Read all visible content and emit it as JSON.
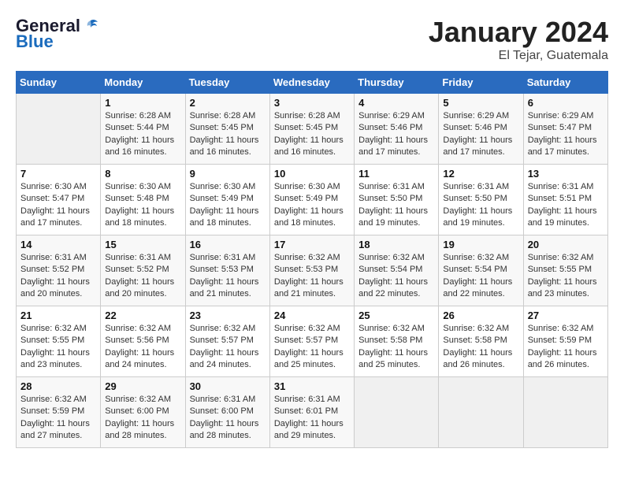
{
  "header": {
    "logo_general": "General",
    "logo_blue": "Blue",
    "month_title": "January 2024",
    "location": "El Tejar, Guatemala"
  },
  "weekdays": [
    "Sunday",
    "Monday",
    "Tuesday",
    "Wednesday",
    "Thursday",
    "Friday",
    "Saturday"
  ],
  "weeks": [
    [
      {
        "day": "",
        "info": ""
      },
      {
        "day": "1",
        "info": "Sunrise: 6:28 AM\nSunset: 5:44 PM\nDaylight: 11 hours\nand 16 minutes."
      },
      {
        "day": "2",
        "info": "Sunrise: 6:28 AM\nSunset: 5:45 PM\nDaylight: 11 hours\nand 16 minutes."
      },
      {
        "day": "3",
        "info": "Sunrise: 6:28 AM\nSunset: 5:45 PM\nDaylight: 11 hours\nand 16 minutes."
      },
      {
        "day": "4",
        "info": "Sunrise: 6:29 AM\nSunset: 5:46 PM\nDaylight: 11 hours\nand 17 minutes."
      },
      {
        "day": "5",
        "info": "Sunrise: 6:29 AM\nSunset: 5:46 PM\nDaylight: 11 hours\nand 17 minutes."
      },
      {
        "day": "6",
        "info": "Sunrise: 6:29 AM\nSunset: 5:47 PM\nDaylight: 11 hours\nand 17 minutes."
      }
    ],
    [
      {
        "day": "7",
        "info": "Sunrise: 6:30 AM\nSunset: 5:47 PM\nDaylight: 11 hours\nand 17 minutes."
      },
      {
        "day": "8",
        "info": "Sunrise: 6:30 AM\nSunset: 5:48 PM\nDaylight: 11 hours\nand 18 minutes."
      },
      {
        "day": "9",
        "info": "Sunrise: 6:30 AM\nSunset: 5:49 PM\nDaylight: 11 hours\nand 18 minutes."
      },
      {
        "day": "10",
        "info": "Sunrise: 6:30 AM\nSunset: 5:49 PM\nDaylight: 11 hours\nand 18 minutes."
      },
      {
        "day": "11",
        "info": "Sunrise: 6:31 AM\nSunset: 5:50 PM\nDaylight: 11 hours\nand 19 minutes."
      },
      {
        "day": "12",
        "info": "Sunrise: 6:31 AM\nSunset: 5:50 PM\nDaylight: 11 hours\nand 19 minutes."
      },
      {
        "day": "13",
        "info": "Sunrise: 6:31 AM\nSunset: 5:51 PM\nDaylight: 11 hours\nand 19 minutes."
      }
    ],
    [
      {
        "day": "14",
        "info": "Sunrise: 6:31 AM\nSunset: 5:52 PM\nDaylight: 11 hours\nand 20 minutes."
      },
      {
        "day": "15",
        "info": "Sunrise: 6:31 AM\nSunset: 5:52 PM\nDaylight: 11 hours\nand 20 minutes."
      },
      {
        "day": "16",
        "info": "Sunrise: 6:31 AM\nSunset: 5:53 PM\nDaylight: 11 hours\nand 21 minutes."
      },
      {
        "day": "17",
        "info": "Sunrise: 6:32 AM\nSunset: 5:53 PM\nDaylight: 11 hours\nand 21 minutes."
      },
      {
        "day": "18",
        "info": "Sunrise: 6:32 AM\nSunset: 5:54 PM\nDaylight: 11 hours\nand 22 minutes."
      },
      {
        "day": "19",
        "info": "Sunrise: 6:32 AM\nSunset: 5:54 PM\nDaylight: 11 hours\nand 22 minutes."
      },
      {
        "day": "20",
        "info": "Sunrise: 6:32 AM\nSunset: 5:55 PM\nDaylight: 11 hours\nand 23 minutes."
      }
    ],
    [
      {
        "day": "21",
        "info": "Sunrise: 6:32 AM\nSunset: 5:55 PM\nDaylight: 11 hours\nand 23 minutes."
      },
      {
        "day": "22",
        "info": "Sunrise: 6:32 AM\nSunset: 5:56 PM\nDaylight: 11 hours\nand 24 minutes."
      },
      {
        "day": "23",
        "info": "Sunrise: 6:32 AM\nSunset: 5:57 PM\nDaylight: 11 hours\nand 24 minutes."
      },
      {
        "day": "24",
        "info": "Sunrise: 6:32 AM\nSunset: 5:57 PM\nDaylight: 11 hours\nand 25 minutes."
      },
      {
        "day": "25",
        "info": "Sunrise: 6:32 AM\nSunset: 5:58 PM\nDaylight: 11 hours\nand 25 minutes."
      },
      {
        "day": "26",
        "info": "Sunrise: 6:32 AM\nSunset: 5:58 PM\nDaylight: 11 hours\nand 26 minutes."
      },
      {
        "day": "27",
        "info": "Sunrise: 6:32 AM\nSunset: 5:59 PM\nDaylight: 11 hours\nand 26 minutes."
      }
    ],
    [
      {
        "day": "28",
        "info": "Sunrise: 6:32 AM\nSunset: 5:59 PM\nDaylight: 11 hours\nand 27 minutes."
      },
      {
        "day": "29",
        "info": "Sunrise: 6:32 AM\nSunset: 6:00 PM\nDaylight: 11 hours\nand 28 minutes."
      },
      {
        "day": "30",
        "info": "Sunrise: 6:31 AM\nSunset: 6:00 PM\nDaylight: 11 hours\nand 28 minutes."
      },
      {
        "day": "31",
        "info": "Sunrise: 6:31 AM\nSunset: 6:01 PM\nDaylight: 11 hours\nand 29 minutes."
      },
      {
        "day": "",
        "info": ""
      },
      {
        "day": "",
        "info": ""
      },
      {
        "day": "",
        "info": ""
      }
    ]
  ]
}
